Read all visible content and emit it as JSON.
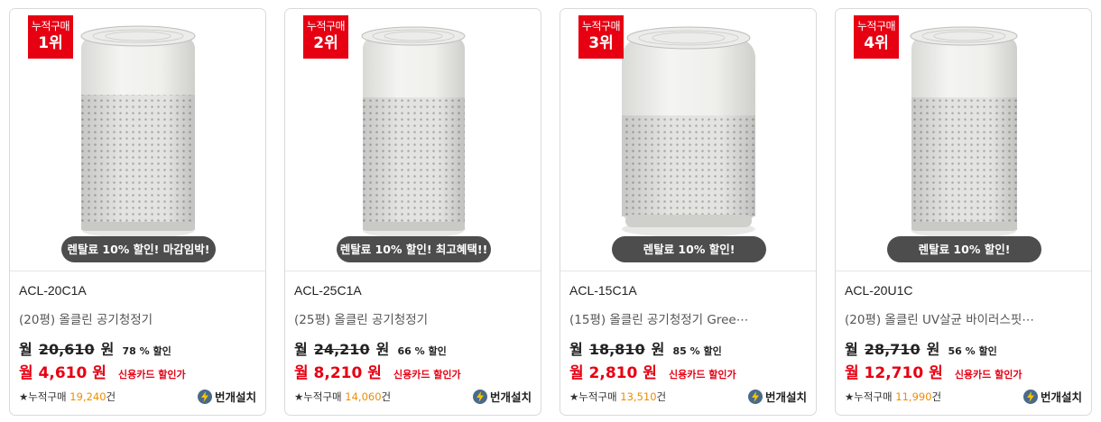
{
  "products": [
    {
      "rank_top": "누적구매",
      "rank_num": "1위",
      "promo": "렌탈료 10% 할인! 마감임박!",
      "model": "ACL-20C1A",
      "name": "(20평) 올클린 공기청정기",
      "orig_prefix": "월",
      "orig_price": "20,610",
      "orig_unit": "원",
      "discount_rate": "78 % 할인",
      "sale_price": "월 4,610 원",
      "sale_note": "신용카드 할인가",
      "sold_label": "★누적구매",
      "sold_count": "19,240",
      "sold_unit": "건",
      "install": "번개설치"
    },
    {
      "rank_top": "누적구매",
      "rank_num": "2위",
      "promo": "렌탈료 10% 할인! 최고혜택!!",
      "model": "ACL-25C1A",
      "name": "(25평) 올클린 공기청정기",
      "orig_prefix": "월",
      "orig_price": "24,210",
      "orig_unit": "원",
      "discount_rate": "66 % 할인",
      "sale_price": "월 8,210 원",
      "sale_note": "신용카드 할인가",
      "sold_label": "★누적구매",
      "sold_count": "14,060",
      "sold_unit": "건",
      "install": "번개설치"
    },
    {
      "rank_top": "누적구매",
      "rank_num": "3위",
      "promo": "렌탈료 10% 할인!",
      "model": "ACL-15C1A",
      "name": "(15평) 올클린 공기청정기 Gree⋯",
      "orig_prefix": "월",
      "orig_price": "18,810",
      "orig_unit": "원",
      "discount_rate": "85 % 할인",
      "sale_price": "월 2,810 원",
      "sale_note": "신용카드 할인가",
      "sold_label": "★누적구매",
      "sold_count": "13,510",
      "sold_unit": "건",
      "install": "번개설치"
    },
    {
      "rank_top": "누적구매",
      "rank_num": "4위",
      "promo": "렌탈료 10% 할인!",
      "model": "ACL-20U1C",
      "name": "(20평) 올클린 UV살균 바이러스핏⋯",
      "orig_prefix": "월",
      "orig_price": "28,710",
      "orig_unit": "원",
      "discount_rate": "56 % 할인",
      "sale_price": "월 12,710 원",
      "sale_note": "신용카드 할인가",
      "sold_label": "★누적구매",
      "sold_count": "11,990",
      "sold_unit": "건",
      "install": "번개설치"
    }
  ],
  "colors": {
    "badge": "#e60012",
    "sale": "#e60012",
    "sold_count": "#f08c00",
    "promo_pill": "#4d4d4d",
    "install_icon": "#4a6a8a"
  },
  "icons": {
    "product_image": "air-purifier-image",
    "install": "lightning-bolt-icon"
  }
}
